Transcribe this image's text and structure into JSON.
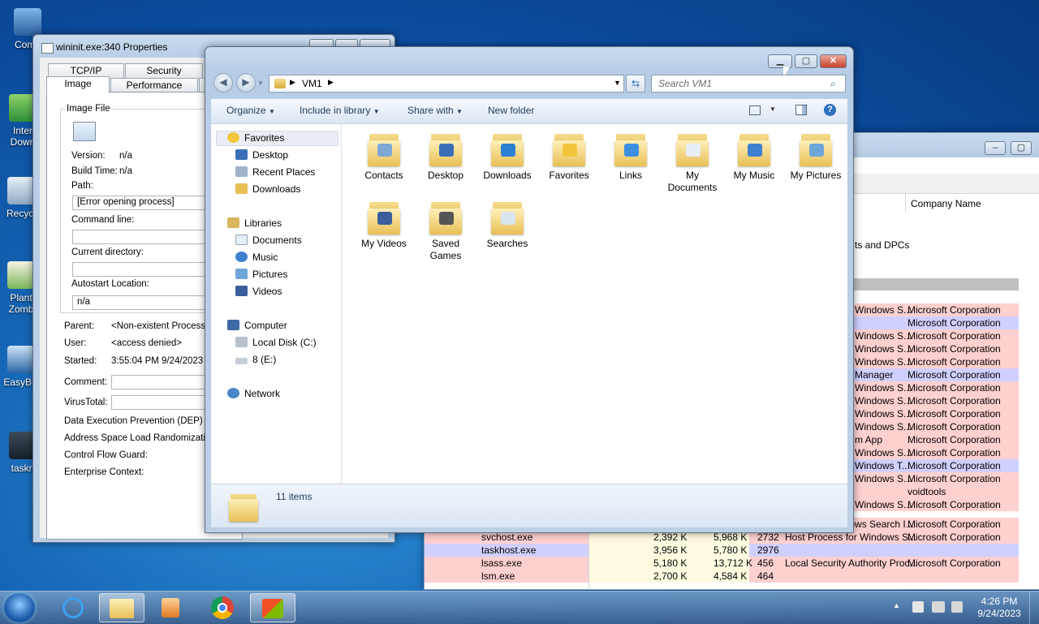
{
  "desktop": {
    "icons": [
      {
        "label": "Comp",
        "label2": ""
      },
      {
        "label": "Inter",
        "label2": "Down"
      },
      {
        "label": "Recycl",
        "label2": ""
      },
      {
        "label": "Plant",
        "label2": "Zomb"
      },
      {
        "label": "EasyBC",
        "label2": ""
      },
      {
        "label": "taskn",
        "label2": ""
      }
    ]
  },
  "properties": {
    "title": "wininit.exe:340 Properties",
    "tabs_row1": [
      "TCP/IP",
      "Security"
    ],
    "tabs_row2": [
      "Image",
      "Performance"
    ],
    "group_label": "Image File",
    "version_label": "Version:",
    "version_value": "n/a",
    "build_time_label": "Build Time:",
    "build_time_value": "n/a",
    "path_label": "Path:",
    "path_value": "[Error opening process]",
    "cmdline_label": "Command line:",
    "curdir_label": "Current directory:",
    "autostart_label": "Autostart Location:",
    "autostart_value": "n/a",
    "parent_label": "Parent:",
    "parent_value": "<Non-existent Process>",
    "user_label": "User:",
    "user_value": "<access denied>",
    "started_label": "Started:",
    "started_value": "3:55:04 PM  9/24/2023",
    "comment_label": "Comment:",
    "virustotal_label": "VirusTotal:",
    "dep_label": "Data Execution Prevention (DEP) Sta",
    "aslr_label": "Address Space Load Randomization:",
    "cfg_label": "Control Flow Guard:",
    "enterprise_label": "Enterprise Context:"
  },
  "procexp": {
    "company_header": "Company Name",
    "row_desc_partial": "ts and DPCs",
    "rows": [
      {
        "desc": "Windows S...",
        "company": "Microsoft Corporation",
        "color": "#ffd0d0"
      },
      {
        "desc": "",
        "company": "Microsoft Corporation",
        "color": "#d0d0ff"
      },
      {
        "desc": "Windows S...",
        "company": "Microsoft Corporation",
        "color": "#ffd0d0"
      },
      {
        "desc": "Windows S...",
        "company": "Microsoft Corporation",
        "color": "#ffd0d0"
      },
      {
        "desc": "Windows S...",
        "company": "Microsoft Corporation",
        "color": "#ffd0d0"
      },
      {
        "desc": "Manager",
        "company": "Microsoft Corporation",
        "color": "#d0d0ff"
      },
      {
        "desc": "Windows S...",
        "company": "Microsoft Corporation",
        "color": "#ffd0d0"
      },
      {
        "desc": "Windows S...",
        "company": "Microsoft Corporation",
        "color": "#ffd0d0"
      },
      {
        "desc": "Windows S...",
        "company": "Microsoft Corporation",
        "color": "#ffd0d0"
      },
      {
        "desc": "Windows S...",
        "company": "Microsoft Corporation",
        "color": "#ffd0d0"
      },
      {
        "desc": "m App",
        "company": "Microsoft Corporation",
        "color": "#ffd0d0"
      },
      {
        "desc": "Windows S...",
        "company": "Microsoft Corporation",
        "color": "#ffd0d0"
      },
      {
        "desc": "Windows T...",
        "company": "Microsoft Corporation",
        "color": "#d0d0ff"
      },
      {
        "desc": "Windows S...",
        "company": "Microsoft Corporation",
        "color": "#ffd0d0"
      },
      {
        "desc": "",
        "company": "voidtools",
        "color": "#ffd0d0"
      },
      {
        "desc": "Windows S...",
        "company": "Microsoft Corporation",
        "color": "#ffd0d0"
      }
    ],
    "lower_rows": [
      {
        "name": "SearchIndexer.exe",
        "private": "",
        "working": "",
        "pid": "2476",
        "desc": "Microsoft Windows Search I...",
        "company": "Microsoft Corporation",
        "color": "#ffd0d0"
      },
      {
        "name": "svchost.exe",
        "private": "2,392 K",
        "working": "5,968 K",
        "pid": "2732",
        "desc": "Host Process for Windows S...",
        "company": "Microsoft Corporation",
        "color": "#ffd0d0"
      },
      {
        "name": "taskhost.exe",
        "private": "3,956 K",
        "working": "5,780 K",
        "pid": "2976",
        "desc": "",
        "company": "",
        "color": "#d0d0ff"
      },
      {
        "name": "lsass.exe",
        "private": "5,180 K",
        "working": "13,712 K",
        "pid": "456",
        "desc": "Local Security Authority Proc...",
        "company": "Microsoft Corporation",
        "color": "#ffd0d0"
      },
      {
        "name": "lsm.exe",
        "private": "2,700 K",
        "working": "4,584 K",
        "pid": "464",
        "desc": "",
        "company": "",
        "color": "#ffd0d0"
      }
    ]
  },
  "explorer": {
    "breadcrumb": "VM1",
    "search_placeholder": "Search VM1",
    "toolbar": {
      "organize": "Organize",
      "include_in_library": "Include in library",
      "share_with": "Share with",
      "new_folder": "New folder"
    },
    "nav": {
      "favorites": "Favorites",
      "desktop": "Desktop",
      "recent_places": "Recent Places",
      "downloads": "Downloads",
      "libraries": "Libraries",
      "documents": "Documents",
      "music": "Music",
      "pictures": "Pictures",
      "videos": "Videos",
      "computer": "Computer",
      "local_disk": "Local Disk (C:)",
      "drive_e": "8 (E:)",
      "network": "Network"
    },
    "folders": [
      {
        "label": "Contacts",
        "badge": "#7fa7d6"
      },
      {
        "label": "Desktop",
        "badge": "#3a6fb8"
      },
      {
        "label": "Downloads",
        "badge": "#2d7fd3"
      },
      {
        "label": "Favorites",
        "badge": "#f2c53b"
      },
      {
        "label": "Links",
        "badge": "#3c8fe0"
      },
      {
        "label": "My\nDocuments",
        "badge": "#e8eef6"
      },
      {
        "label": "My Music",
        "badge": "#3f7fd0"
      },
      {
        "label": "My Pictures",
        "badge": "#6ea6d8"
      },
      {
        "label": "My Videos",
        "badge": "#3b5f9c"
      },
      {
        "label": "Saved\nGames",
        "badge": "#555555"
      },
      {
        "label": "Searches",
        "badge": "#d9e4ef"
      }
    ],
    "status": "11 items"
  },
  "taskbar": {
    "time": "4:26 PM",
    "date": "9/24/2023"
  }
}
